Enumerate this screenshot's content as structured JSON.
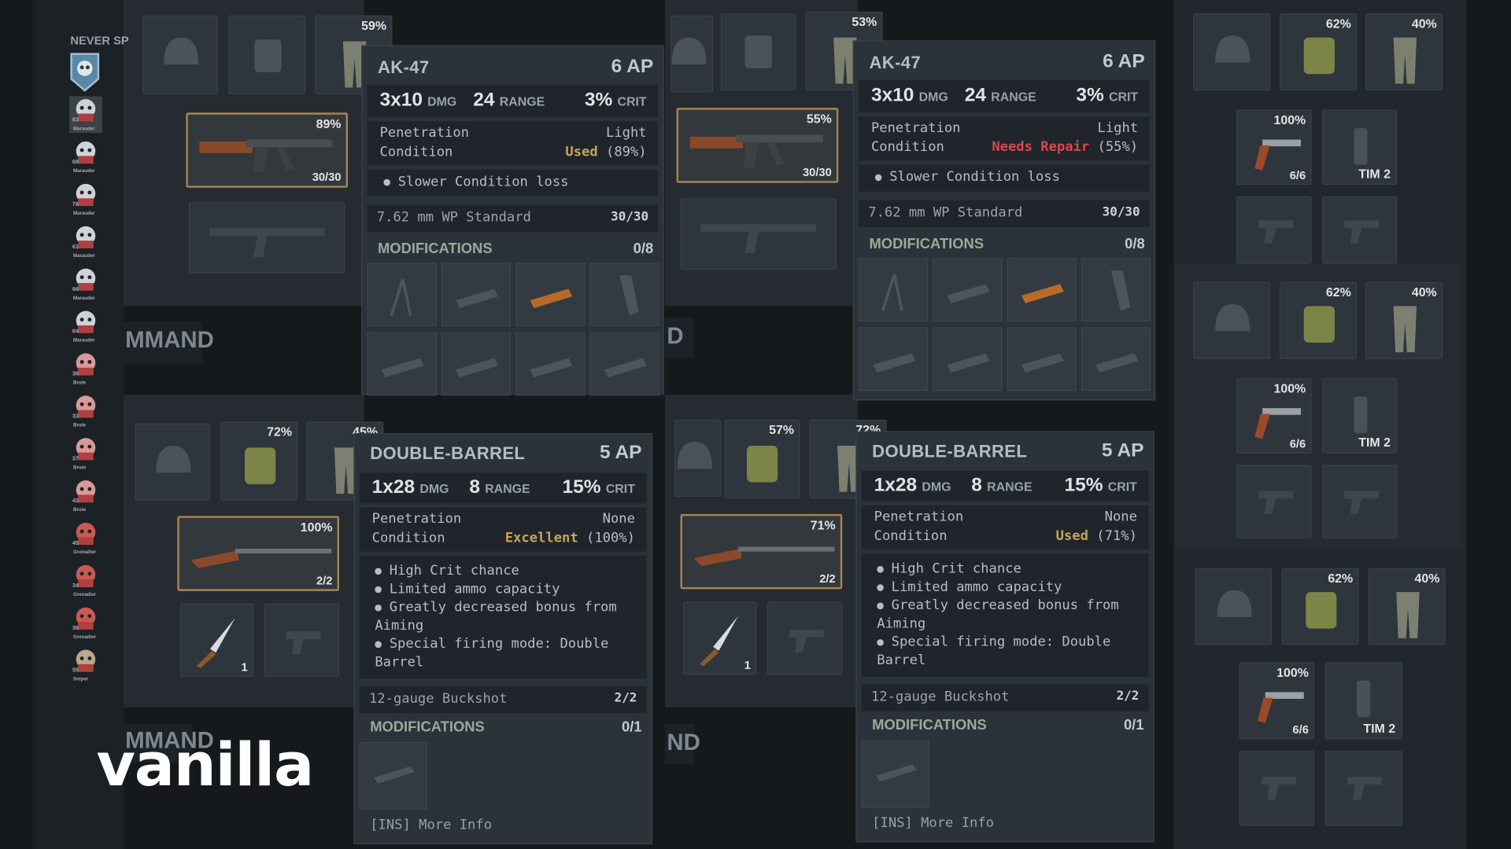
{
  "overlay_label": "vanilla",
  "squad": {
    "header": "NEVER SP",
    "members": [
      {
        "role": "Marauder",
        "level": "83",
        "color": "#cfd3d8"
      },
      {
        "role": "Marauder",
        "level": "68",
        "color": "#cfd3d8"
      },
      {
        "role": "Marauder",
        "level": "76",
        "color": "#cfd3d8"
      },
      {
        "role": "Marauder",
        "level": "61",
        "color": "#cfd3d8"
      },
      {
        "role": "Marauder",
        "level": "66",
        "color": "#cfd3d8"
      },
      {
        "role": "Marauder",
        "level": "64",
        "color": "#cfd3d8"
      },
      {
        "role": "Brute",
        "level": "36",
        "color": "#d69a9a"
      },
      {
        "role": "Brute",
        "level": "33",
        "color": "#d69a9a"
      },
      {
        "role": "Brute",
        "level": "37",
        "color": "#d69a9a"
      },
      {
        "role": "Brute",
        "level": "43",
        "color": "#d69a9a"
      },
      {
        "role": "Grenadier",
        "level": "45",
        "color": "#c95a52"
      },
      {
        "role": "Grenadier",
        "level": "34",
        "color": "#c95a52"
      },
      {
        "role": "Grenadier",
        "level": "36",
        "color": "#c95a52"
      },
      {
        "role": "Sniper",
        "level": "55",
        "color": "#b8a98a"
      }
    ]
  },
  "bg_text": {
    "command_1": "MMAND",
    "command_2": "D",
    "command_3": "MMAND",
    "command_4": "ND"
  },
  "slots": {
    "q1_pants_pct": "59%",
    "q1_ak_pct": "89%",
    "q1_ak_ammo": "30/30",
    "q2_pants_pct": "53%",
    "q2_ak_pct": "55%",
    "q2_ak_ammo": "30/30",
    "q3_vest_pct": "72%",
    "q3_pants_pct": "45%",
    "q3_db_pct": "100%",
    "q3_db_ammo": "2/2",
    "q3_knife_count": "1",
    "q4_vest_pct": "57%",
    "q4_pants_pct": "72%",
    "q4_db_pct": "71%",
    "q4_db_ammo": "2/2",
    "q4_knife_count": "1",
    "r1_vest_pct": "62%",
    "r1_pants_pct": "40%",
    "r1_rev_pct": "100%",
    "r1_rev_ammo": "6/6",
    "r1_tim": "TIM 2",
    "r2_vest_pct": "62%",
    "r2_pants_pct": "40%",
    "r2_rev_pct": "100%",
    "r2_rev_ammo": "6/6",
    "r2_tim": "TIM 2",
    "r3_vest_pct": "62%",
    "r3_pants_pct": "40%",
    "r3_rev_pct": "100%",
    "r3_rev_ammo": "6/6",
    "r3_tim": "TIM 2"
  },
  "tooltips": {
    "ak1": {
      "name": "AK-47",
      "ap": "6 AP",
      "dmg_val": "3x10",
      "dmg_unit": "DMG",
      "range_val": "24",
      "range_unit": "RANGE",
      "crit_val": "3%",
      "crit_unit": "CRIT",
      "pen_label": "Penetration",
      "pen_value": "Light",
      "cond_label": "Condition",
      "cond_state": "Used",
      "cond_pct": "(89%)",
      "cond_color": "#c7a45a",
      "traits": [
        "Slower Condition loss"
      ],
      "ammo_name": "7.62 mm WP Standard",
      "ammo_count": "30/30",
      "mods_label": "MODIFICATIONS",
      "mods_count": "0/8"
    },
    "ak2": {
      "name": "AK-47",
      "ap": "6 AP",
      "dmg_val": "3x10",
      "dmg_unit": "DMG",
      "range_val": "24",
      "range_unit": "RANGE",
      "crit_val": "3%",
      "crit_unit": "CRIT",
      "pen_label": "Penetration",
      "pen_value": "Light",
      "cond_label": "Condition",
      "cond_state": "Needs Repair",
      "cond_pct": "(55%)",
      "cond_color": "#e0454a",
      "traits": [
        "Slower Condition loss"
      ],
      "ammo_name": "7.62 mm WP Standard",
      "ammo_count": "30/30",
      "mods_label": "MODIFICATIONS",
      "mods_count": "0/8"
    },
    "db1": {
      "name": "DOUBLE-BARREL",
      "ap": "5 AP",
      "dmg_val": "1x28",
      "dmg_unit": "DMG",
      "range_val": "8",
      "range_unit": "RANGE",
      "crit_val": "15%",
      "crit_unit": "CRIT",
      "pen_label": "Penetration",
      "pen_value": "None",
      "cond_label": "Condition",
      "cond_state": "Excellent",
      "cond_pct": "(100%)",
      "cond_color": "#c7a45a",
      "traits": [
        "High Crit chance",
        "Limited ammo capacity",
        "Greatly decreased bonus from Aiming",
        "Special firing mode: Double Barrel"
      ],
      "ammo_name": "12-gauge Buckshot",
      "ammo_count": "2/2",
      "mods_label": "MODIFICATIONS",
      "mods_count": "0/1",
      "more_info": "[INS] More Info"
    },
    "db2": {
      "name": "DOUBLE-BARREL",
      "ap": "5 AP",
      "dmg_val": "1x28",
      "dmg_unit": "DMG",
      "range_val": "8",
      "range_unit": "RANGE",
      "crit_val": "15%",
      "crit_unit": "CRIT",
      "pen_label": "Penetration",
      "pen_value": "None",
      "cond_label": "Condition",
      "cond_state": "Used",
      "cond_pct": "(71%)",
      "cond_color": "#c7a45a",
      "traits": [
        "High Crit chance",
        "Limited ammo capacity",
        "Greatly decreased bonus from Aiming",
        "Special firing mode: Double Barrel"
      ],
      "ammo_name": "12-gauge Buckshot",
      "ammo_count": "2/2",
      "mods_label": "MODIFICATIONS",
      "mods_count": "0/1",
      "more_info": "[INS] More Info"
    }
  }
}
